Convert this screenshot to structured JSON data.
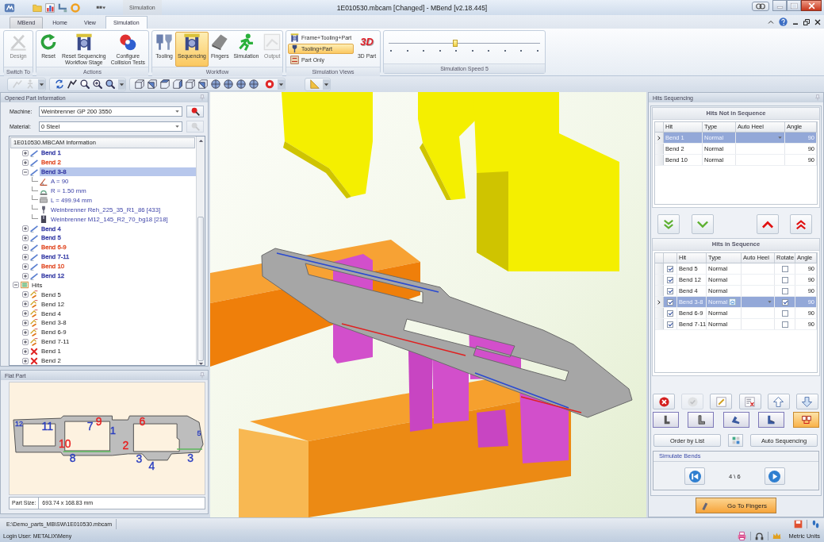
{
  "title_bar": {
    "context_tab": "Simulation",
    "title": "1E010530.mbcam [Changed] - MBend [v2.18.445]"
  },
  "ribbon": {
    "tabs": [
      {
        "label": "MBend",
        "kind": "application",
        "selected": false
      },
      {
        "label": "Home",
        "kind": "tab",
        "selected": false
      },
      {
        "label": "View",
        "kind": "tab",
        "selected": false
      },
      {
        "label": "Simulation",
        "kind": "tab",
        "selected": true
      }
    ],
    "groups": [
      {
        "label": "Switch To",
        "kind": "buttons",
        "buttons": [
          {
            "lines": [
              "Design"
            ],
            "kind": "large",
            "disabled": true
          }
        ]
      },
      {
        "label": "Actions",
        "kind": "buttons",
        "buttons": [
          {
            "lines": [
              "Reset"
            ],
            "kind": "large"
          },
          {
            "lines": [
              "Reset Sequencing",
              "Workflow Stage"
            ],
            "kind": "large"
          },
          {
            "lines": [
              "Configure",
              "Collision Tests"
            ],
            "kind": "large"
          }
        ]
      },
      {
        "label": "Workflow",
        "kind": "buttons",
        "buttons": [
          {
            "lines": [
              "Tooling"
            ],
            "kind": "large",
            "selected": false,
            "disabled": false
          },
          {
            "lines": [
              "Sequencing"
            ],
            "kind": "large",
            "selected": true,
            "disabled": false
          },
          {
            "lines": [
              "Fingers"
            ],
            "kind": "large",
            "selected": false,
            "disabled": false
          },
          {
            "lines": [
              "Simulation"
            ],
            "kind": "large",
            "selected": false,
            "disabled": false
          },
          {
            "lines": [
              "Output"
            ],
            "kind": "large",
            "selected": false,
            "disabled": true
          }
        ]
      },
      {
        "label": "Simulation Views",
        "kind": "buttons",
        "buttons": [
          {
            "label": "Frame+Tooling+Part",
            "kind": "small",
            "selected": false
          },
          {
            "label": "Tooling+Part",
            "kind": "small",
            "selected": true
          },
          {
            "label": "Part Only",
            "kind": "small",
            "selected": false
          },
          {
            "lines": [
              "3D Part"
            ],
            "kind": "large",
            "icon_text": "3D",
            "selected": false
          }
        ]
      },
      {
        "label": "Simulation Speed 5",
        "kind": "slider",
        "level": 0.44
      }
    ]
  },
  "toolbar": [
    {
      "buttons": [
        {
          "disabled": true
        },
        {
          "disabled": true
        }
      ]
    },
    {
      "buttons": [
        {
          "disabled": false
        },
        {
          "disabled": false
        },
        {
          "disabled": false
        },
        {
          "disabled": false
        },
        {
          "disabled": false
        }
      ]
    },
    {
      "buttons": [
        {
          "disabled": false
        },
        {
          "disabled": false
        },
        {
          "disabled": false
        },
        {
          "disabled": false
        },
        {
          "disabled": false
        },
        {
          "disabled": false
        },
        {
          "disabled": false
        },
        {
          "disabled": false
        },
        {
          "disabled": false
        },
        {
          "disabled": false
        },
        {
          "disabled": false
        }
      ]
    },
    {
      "buttons": [
        {
          "disabled": false
        }
      ]
    }
  ],
  "part_info": {
    "title": "Opened Part Information",
    "fields": [
      {
        "label": "Machine:",
        "value": "Weinbrenner GP 200 3550",
        "picker_disabled": false
      },
      {
        "label": "Material:",
        "value": "0 Steel",
        "picker_disabled": true
      }
    ],
    "tree": {
      "header": "1E010530.MBCAM Information",
      "nodes": [
        {
          "children": [
            {
              "label": "Bend 1",
              "kind": "bend",
              "color": "#3c42a8",
              "expanded": false,
              "selected": false
            },
            {
              "label": "Bend 2",
              "kind": "bend",
              "color": "#e2502c",
              "expanded": false,
              "selected": false
            },
            {
              "label": "Bend 3-8",
              "kind": "bend",
              "color": "#3c42a8",
              "expanded": true,
              "selected": true,
              "children": [
                {
                  "label": "A = 90",
                  "kind": "angle",
                  "selected": false
                },
                {
                  "label": "R = 1.50 mm",
                  "kind": "radius",
                  "selected": false
                },
                {
                  "label": "L = 499.94 mm",
                  "kind": "length",
                  "selected": false
                },
                {
                  "label": "Weinbrenner Reh_225_35_R1_86 [433]",
                  "kind": "punch",
                  "selected": false
                },
                {
                  "label": "Weinbrenner M12_145_R2_70_bg18 [218]",
                  "kind": "die",
                  "selected": false
                }
              ]
            },
            {
              "label": "Bend 4",
              "kind": "bend",
              "color": "#3c42a8",
              "expanded": false,
              "selected": false
            },
            {
              "label": "Bend 5",
              "kind": "bend",
              "color": "#3c42a8",
              "expanded": false,
              "selected": false
            },
            {
              "label": "Bend 6-9",
              "kind": "bend",
              "color": "#e2502c",
              "expanded": false,
              "selected": false
            },
            {
              "label": "Bend 7-11",
              "kind": "bend",
              "color": "#3c42a8",
              "expanded": false,
              "selected": false
            },
            {
              "label": "Bend 10",
              "kind": "bend",
              "color": "#e2502c",
              "expanded": false,
              "selected": false
            },
            {
              "label": "Bend 12",
              "kind": "bend",
              "color": "#3c42a8",
              "expanded": false,
              "selected": false
            }
          ]
        },
        {
          "label": "Hits",
          "kind": "hits",
          "expanded": true,
          "selected": false,
          "children": [
            {
              "label": "Bend 5",
              "kind": "hit",
              "expanded": false,
              "selected": false
            },
            {
              "label": "Bend 12",
              "kind": "hit",
              "expanded": false,
              "selected": false
            },
            {
              "label": "Bend 4",
              "kind": "hit",
              "expanded": false,
              "selected": false
            },
            {
              "label": "Bend 3-8",
              "kind": "hit",
              "expanded": false,
              "selected": false
            },
            {
              "label": "Bend 6-9",
              "kind": "hit",
              "expanded": false,
              "selected": false
            },
            {
              "label": "Bend 7-11",
              "kind": "hit",
              "expanded": false,
              "selected": false
            },
            {
              "label": "Bend 1",
              "kind": "removed",
              "expanded": false,
              "selected": false
            },
            {
              "label": "Bend 2",
              "kind": "removed",
              "expanded": false,
              "selected": false
            }
          ]
        }
      ]
    }
  },
  "flat_part": {
    "title": "Flat Part",
    "labels": [
      {
        "text": "12",
        "color": "#2b3fc0"
      },
      {
        "text": "11",
        "color": "#2b3fc0"
      },
      {
        "text": "7",
        "color": "#2b3fc0"
      },
      {
        "text": "9",
        "color": "#e82020"
      },
      {
        "text": "1",
        "color": "#2b3fc0"
      },
      {
        "text": "6",
        "color": "#e82020"
      },
      {
        "text": "5",
        "color": "#2b3fc0"
      },
      {
        "text": "10",
        "color": "#e82020"
      },
      {
        "text": "8",
        "color": "#2b3fc0"
      },
      {
        "text": "2",
        "color": "#e82020"
      },
      {
        "text": "3",
        "color": "#2b3fc0"
      },
      {
        "text": "4",
        "color": "#2b3fc0"
      },
      {
        "text": "3",
        "color": "#2b3fc0"
      }
    ],
    "size_label": "Part Size:",
    "size": "693.74 x 168.83 mm"
  },
  "hits_sequencing": {
    "title": "Hits Sequencing",
    "not_in_sequence": {
      "title": "Hits Not in Sequence",
      "columns": [
        "Hit",
        "Type",
        "Auto Heel",
        "Angle"
      ],
      "rows": [
        {
          "hit": "Bend 1",
          "type": "Normal",
          "angle": "90",
          "selected": true
        },
        {
          "hit": "Bend 2",
          "type": "Normal",
          "angle": "90",
          "selected": false
        },
        {
          "hit": "Bend 10",
          "type": "Normal",
          "angle": "90",
          "selected": false
        }
      ]
    },
    "in_sequence": {
      "title": "Hits in Sequence",
      "columns": [
        "Hit",
        "Type",
        "Auto Heel",
        "Rotate",
        "Angle"
      ],
      "rows": [
        {
          "checked": true,
          "hit": "Bend 5",
          "type": "Normal",
          "rotate": false,
          "angle": "90",
          "selected": false
        },
        {
          "checked": true,
          "hit": "Bend 12",
          "type": "Normal",
          "rotate": false,
          "angle": "90",
          "selected": false
        },
        {
          "checked": true,
          "hit": "Bend 4",
          "type": "Normal",
          "rotate": false,
          "angle": "90",
          "selected": false
        },
        {
          "checked": true,
          "hit": "Bend 3-8",
          "type": "Normal",
          "rotate": true,
          "angle": "90",
          "selected": true
        },
        {
          "checked": true,
          "hit": "Bend 6-9",
          "type": "Normal",
          "rotate": false,
          "angle": "90",
          "selected": false
        },
        {
          "checked": true,
          "hit": "Bend 7-11",
          "type": "Normal",
          "rotate": false,
          "angle": "90",
          "selected": false
        }
      ]
    },
    "tool_buttons": [
      {
        "disabled": false
      },
      {
        "disabled": true
      },
      {
        "disabled": false
      },
      {
        "disabled": false
      },
      {
        "disabled": false
      },
      {
        "disabled": false
      }
    ],
    "mode_buttons": [
      {
        "selected": false
      },
      {
        "selected": false
      },
      {
        "selected": false
      },
      {
        "selected": false
      },
      {
        "selected": true
      }
    ],
    "order_button": "Order by List",
    "auto_button": "Auto Sequencing",
    "simulate": {
      "title": "Simulate Bends",
      "counter": "4 \\ 6"
    },
    "fingers_button": "Go To Fingers"
  },
  "status_bar": {
    "path": "E:\\Demo_parts_MB\\SW\\1E010530.mbcam",
    "user": "Login User: METALIX\\Meny",
    "units": "Metric Units"
  }
}
